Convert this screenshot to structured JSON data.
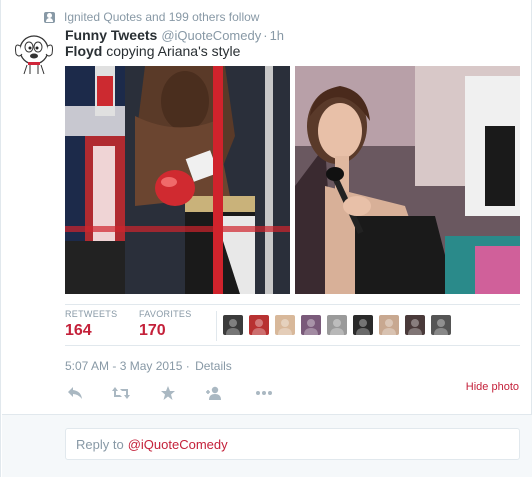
{
  "context": {
    "text": "Ignited Quotes and 199 others follow",
    "icon": "follow-icon"
  },
  "tweet": {
    "fullname": "Funny Tweets",
    "username": "@iQuoteComedy",
    "dot": "·",
    "time": "1h",
    "text_bold": "Floyd",
    "text_rest": " copying Ariana's style"
  },
  "photos": [
    {
      "name": "boxer-photo"
    },
    {
      "name": "singer-photo"
    }
  ],
  "stats": {
    "retweets_label": "RETWEETS",
    "retweets_value": "164",
    "favorites_label": "FAVORITES",
    "favorites_value": "170",
    "favoriter_avatars": [
      "#3b3b3b",
      "#b83232",
      "#d8b89a",
      "#7a5a7a",
      "#9a9a9a",
      "#2a2a2a",
      "#c8a890",
      "#4a3a3a",
      "#555555"
    ]
  },
  "timestamp": {
    "text": "5:07 AM - 3 May 2015",
    "dot": "·",
    "details": "Details"
  },
  "actions": {
    "hide_photo": "Hide photo",
    "icons": [
      "reply-icon",
      "retweet-icon",
      "favorite-icon",
      "follow-icon",
      "more-icon"
    ]
  },
  "reply": {
    "prefix": "Reply to",
    "mention": "@iQuoteComedy"
  },
  "colors": {
    "accent": "#c4213a",
    "muted": "#8899a6",
    "text": "#292f33",
    "border": "#e1e8ed"
  }
}
